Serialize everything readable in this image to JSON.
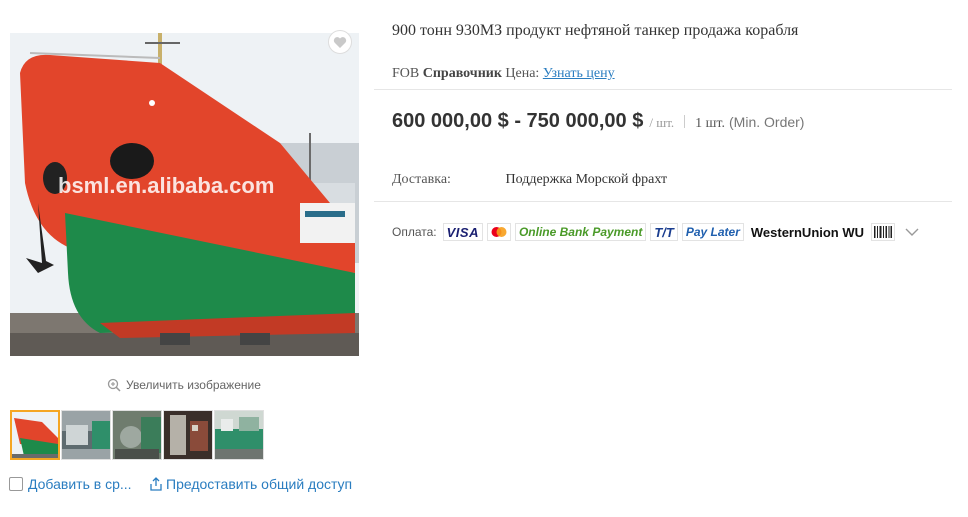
{
  "product": {
    "title": "900 тонн 930МЗ продукт нефтяной танкер продажа корабля",
    "fob_prefix": "FOB",
    "fob_bold": "Справочник",
    "fob_price_label": "Цена:",
    "fob_link": "Узнать цену",
    "price_range": "600 000,00 $ - 750 000,00 $",
    "price_unit": "/ шт.",
    "moq_value": "1 шт.",
    "moq_label": "(Min. Order)",
    "shipping_label": "Доставка:",
    "shipping_value": "Поддержка Морской фрахт",
    "payment_label": "Оплата:",
    "payment_methods": [
      "VISA",
      "Online Bank Payment",
      "T/T",
      "Pay Later",
      "WesternUnion WU"
    ]
  },
  "gallery": {
    "watermark": "bsml.en.alibaba.com",
    "zoom_label": "Увеличить изображение",
    "thumbnail_count": 5,
    "active_thumbnail": 1,
    "compare_label": "Добавить в ср...",
    "share_label": "Предоставить общий доступ"
  },
  "colors": {
    "link": "#2a7dc0",
    "active_thumb_border": "#f5a623",
    "hull_red": "#e2452b",
    "hull_green": "#1e8a4a"
  }
}
